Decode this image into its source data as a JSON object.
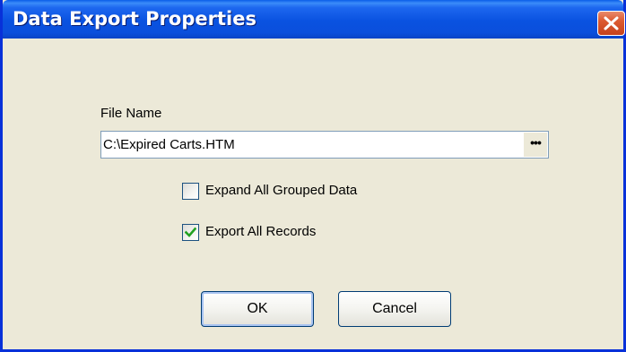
{
  "window": {
    "title": "Data Export Properties",
    "close_icon": "close-icon"
  },
  "form": {
    "file_name_label": "File Name",
    "file_name_value": "C:\\Expired Carts.HTM",
    "browse_label": "•••",
    "checkboxes": [
      {
        "label": "Expand All Grouped Data",
        "checked": false
      },
      {
        "label": "Export All Records",
        "checked": true
      }
    ]
  },
  "buttons": {
    "ok_label": "OK",
    "cancel_label": "Cancel"
  },
  "colors": {
    "titlebar": "#0a52e0",
    "dialog_background": "#ece9d8",
    "checkmark": "#21a121",
    "close_button": "#dc5a31"
  }
}
